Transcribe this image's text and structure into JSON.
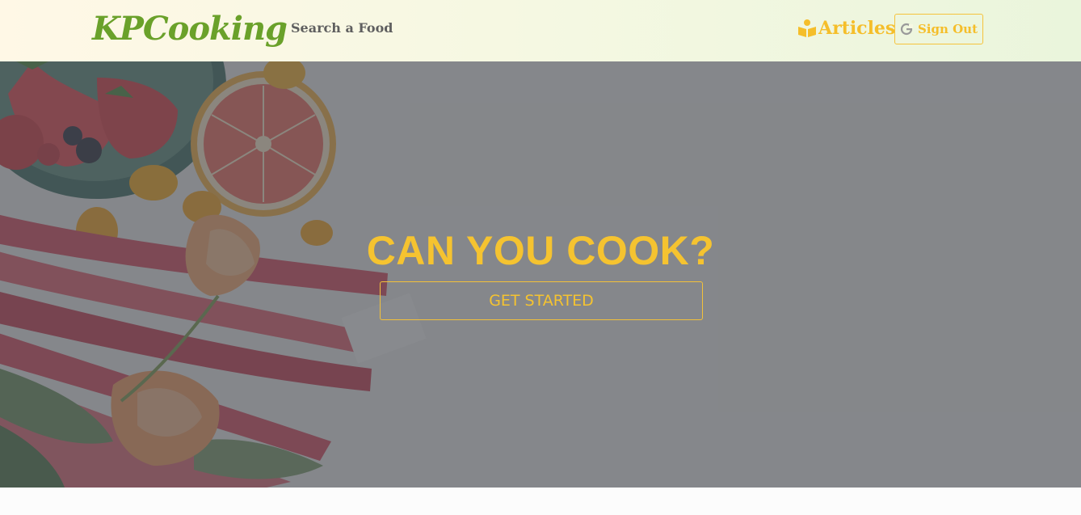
{
  "navbar": {
    "brand": "KPCooking",
    "search_link": "Search a Food",
    "articles_link": "Articles",
    "articles_icon": "book-reader-icon",
    "sign_out_label": "Sign Out",
    "sign_out_icon": "google-icon"
  },
  "hero": {
    "title": "CAN YOU COOK?",
    "cta_label": "GET STARTED",
    "background_image": "food-photo"
  },
  "colors": {
    "brand_green": "#6aa12a",
    "accent_yellow": "#f5c330",
    "nav_text_gray": "#5f5f5f"
  }
}
